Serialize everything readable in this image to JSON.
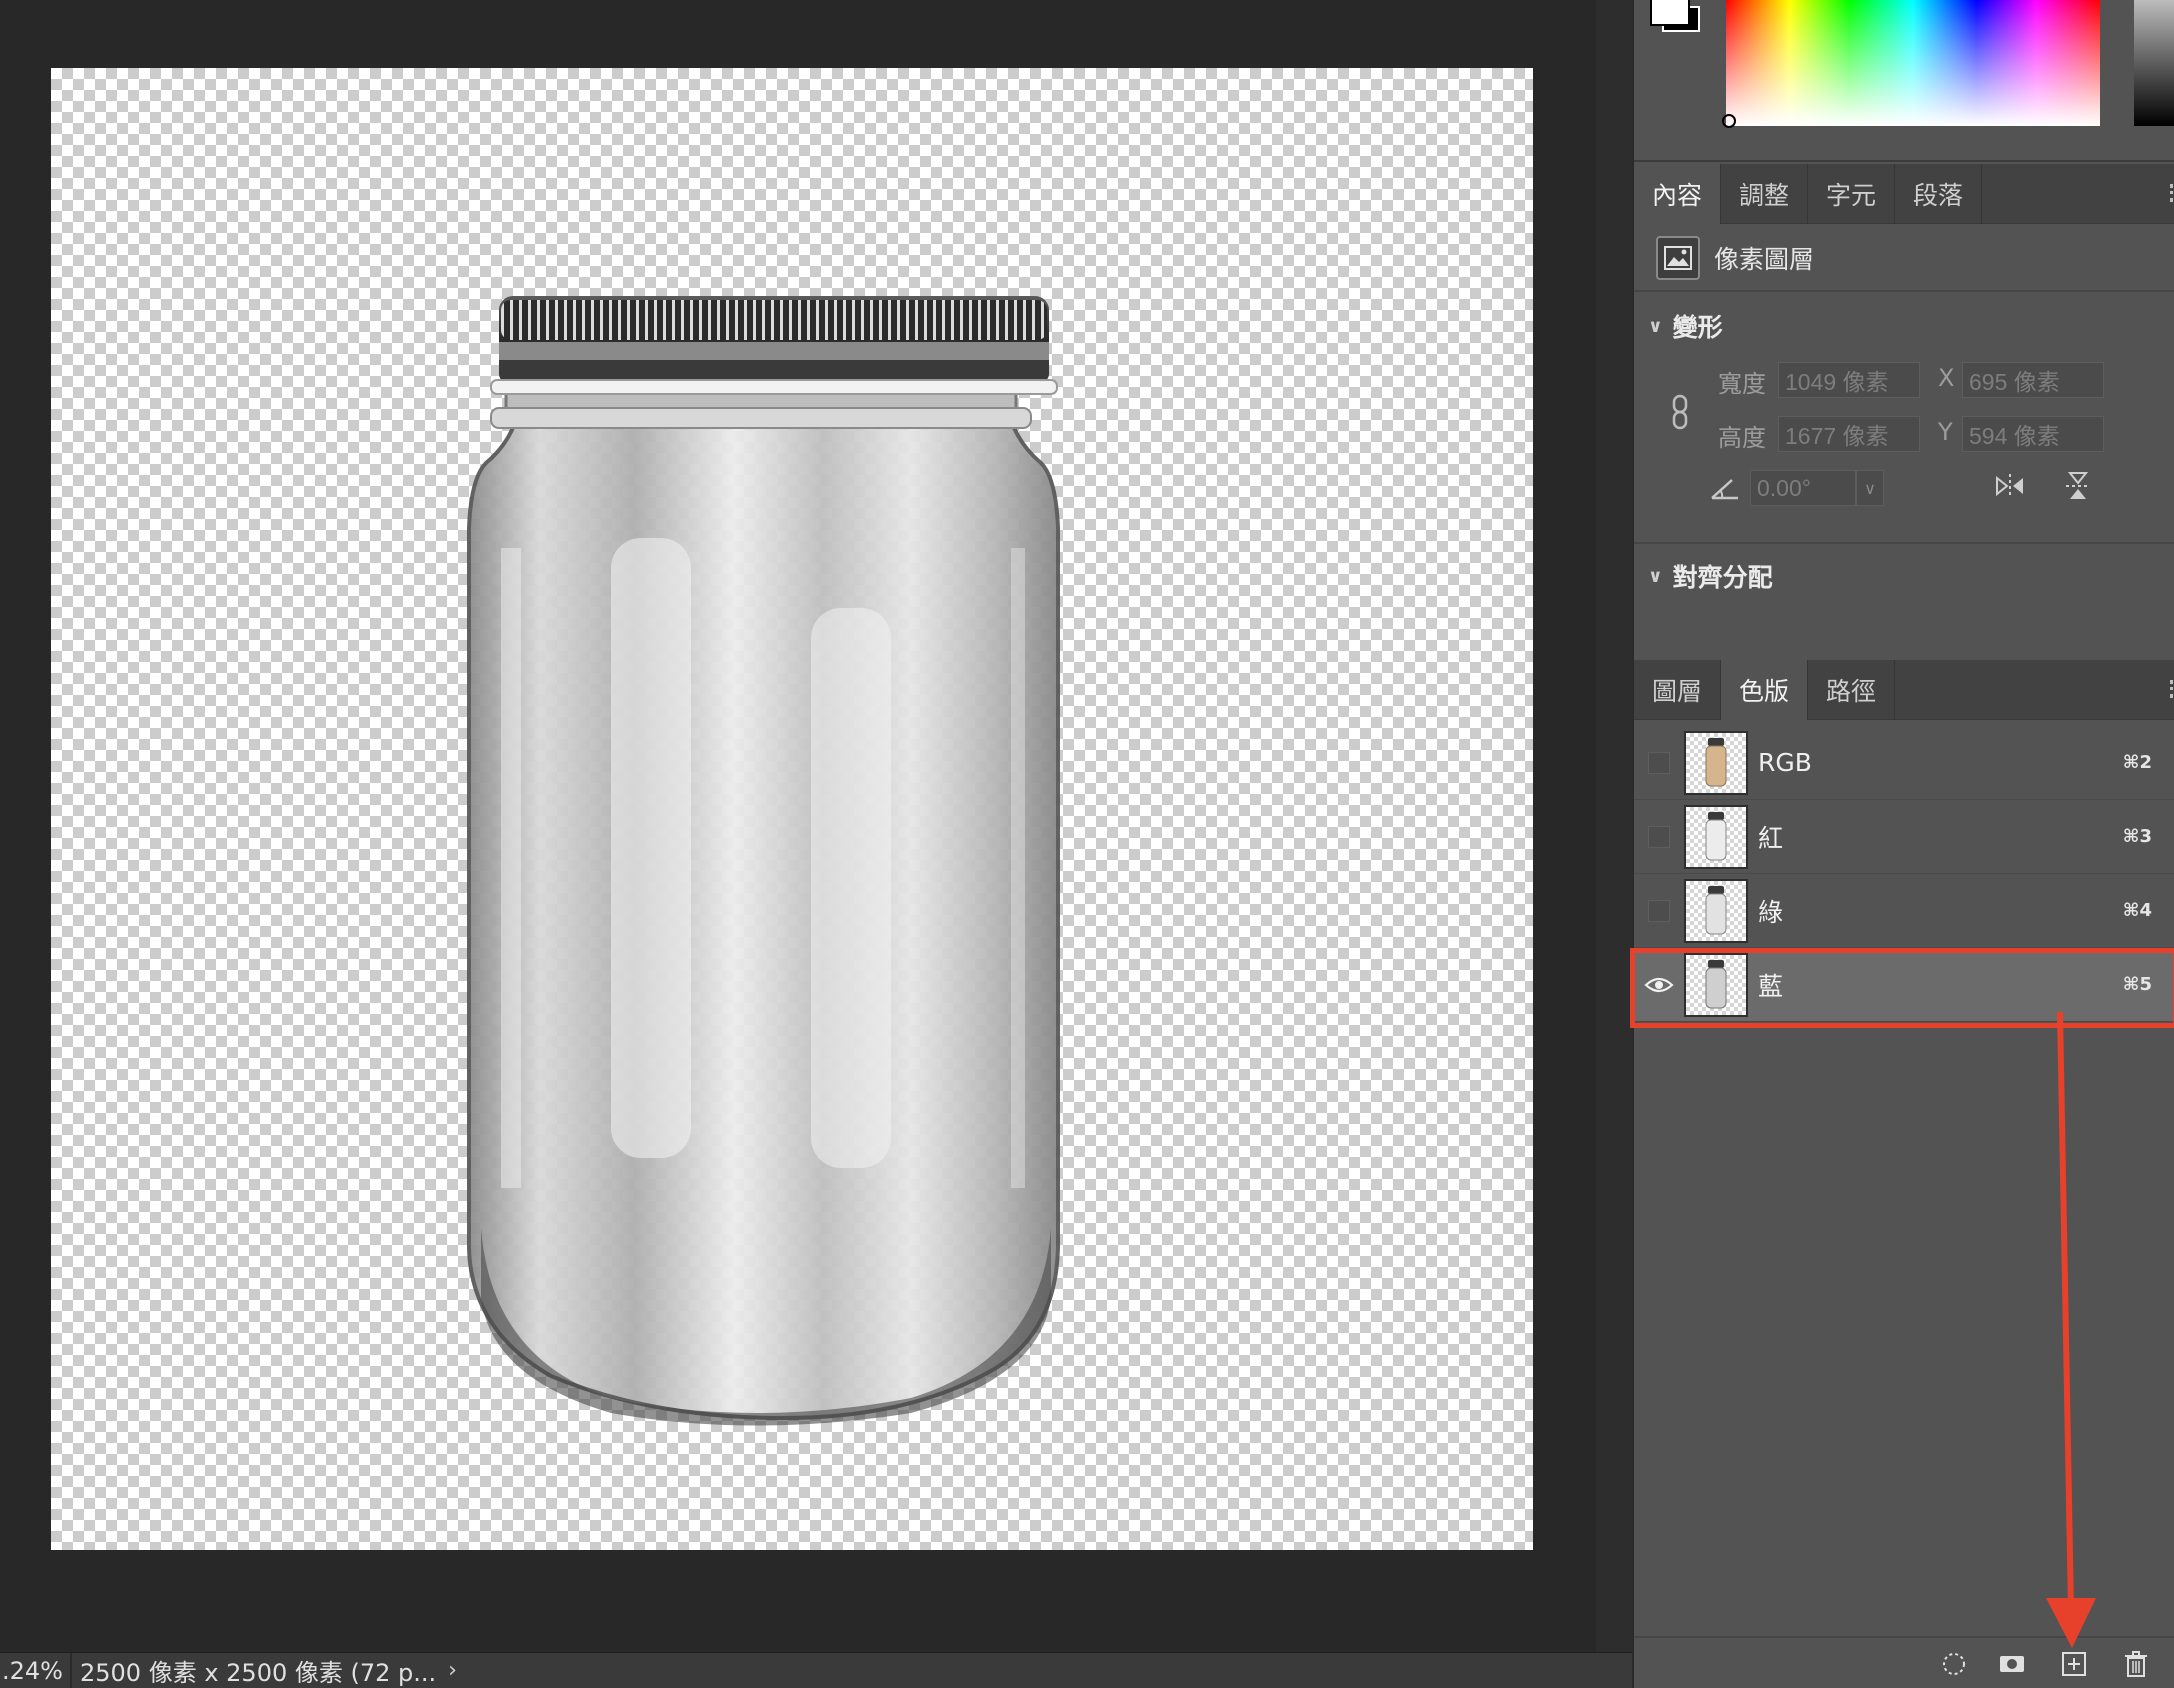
{
  "colors": {
    "accent_red": "#e8412b",
    "panel_bg": "#535353",
    "canvas_bg": "#282828"
  },
  "status_bar": {
    "zoom": ".24%",
    "doc_info": "2500 像素 x 2500 像素 (72 p...",
    "arrow": "›"
  },
  "properties": {
    "tabs": [
      "內容",
      "調整",
      "字元",
      "段落"
    ],
    "layer_kind": "像素圖層",
    "transform": {
      "title": "變形",
      "width_label": "寬度",
      "width_value": "1049 像素",
      "height_label": "高度",
      "height_value": "1677 像素",
      "x_label": "X",
      "x_value": "695 像素",
      "y_label": "Y",
      "y_value": "594 像素",
      "angle_value": "0.00°"
    },
    "align_title": "對齊分配"
  },
  "layers_panel": {
    "tabs": [
      "圖層",
      "色版",
      "路徑"
    ],
    "active_tab": "色版",
    "channels": [
      {
        "name": "RGB",
        "shortcut": "⌘2",
        "visible": false
      },
      {
        "name": "紅",
        "shortcut": "⌘3",
        "visible": false
      },
      {
        "name": "綠",
        "shortcut": "⌘4",
        "visible": false
      },
      {
        "name": "藍",
        "shortcut": "⌘5",
        "visible": true,
        "selected": true
      }
    ],
    "toolbar_icons": [
      "load-selection-icon",
      "save-selection-icon",
      "new-channel-icon",
      "trash-icon"
    ]
  }
}
